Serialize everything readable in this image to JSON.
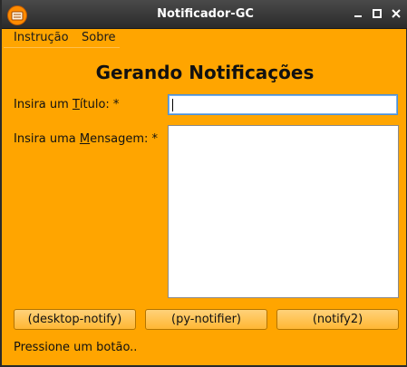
{
  "window": {
    "title": "Notificador-GC"
  },
  "menu": {
    "items": [
      {
        "label": "Instrução"
      },
      {
        "label": "Sobre"
      }
    ]
  },
  "form": {
    "heading": "Gerando Notificações",
    "title_label_pre": "Insira um ",
    "title_label_mnemonic": "T",
    "title_label_post": "ítulo: *",
    "title_value": "",
    "message_label_pre": "Insira uma ",
    "message_label_mnemonic": "M",
    "message_label_post": "ensagem: *",
    "message_value": ""
  },
  "buttons": {
    "desktop_notify": "(desktop-notify)",
    "py_notifier": "(py-notifier)",
    "notify2": "(notify2)"
  },
  "status": {
    "text": "Pressione um botão.."
  },
  "colors": {
    "background": "#ffa500",
    "titlebar": "#2b2b2b"
  },
  "icons": {
    "app": "app-notify-icon",
    "minimize": "minimize-icon",
    "maximize": "maximize-icon",
    "close": "close-icon"
  }
}
